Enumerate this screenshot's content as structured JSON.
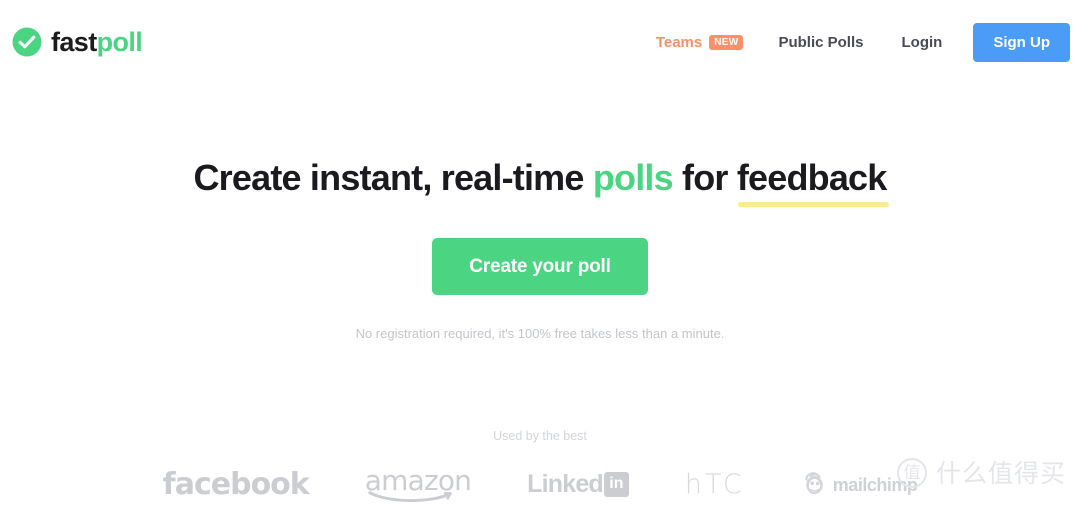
{
  "colors": {
    "brand_green": "#4bd583",
    "accent_blue": "#4a9cf7",
    "accent_orange": "#fb9069",
    "highlight_yellow": "#fbeb8e",
    "text_dark": "#1b1b1f",
    "text_muted": "#c3c5ca",
    "logo_gray": "#cbcdd1"
  },
  "header": {
    "logo": {
      "icon": "check-circle-icon",
      "word_one": "fast",
      "word_two": "poll"
    },
    "nav": {
      "teams": {
        "label": "Teams",
        "badge": "NEW"
      },
      "public_polls": "Public Polls",
      "login": "Login",
      "signup": "Sign Up"
    }
  },
  "hero": {
    "headline": {
      "part_one": "Create instant, real-time ",
      "accent": "polls",
      "part_two": " for ",
      "underlined": "feedback",
      "full_text": "Create instant, real-time polls for feedback"
    },
    "cta_label": "Create your poll",
    "subtext": "No registration required, it's 100% free takes less than a minute."
  },
  "social_proof": {
    "label": "Used by the best",
    "logos": [
      {
        "name": "facebook-logo",
        "text": "facebook"
      },
      {
        "name": "amazon-logo",
        "text": "amazon"
      },
      {
        "name": "linkedin-logo",
        "text": "Linked",
        "mark": "in"
      },
      {
        "name": "htc-logo",
        "text": "hTC"
      },
      {
        "name": "mailchimp-logo",
        "text": "mailchimp",
        "icon": "mailchimp-monkey-icon"
      }
    ]
  },
  "watermark": {
    "badge": "值",
    "text": "什么值得买"
  }
}
